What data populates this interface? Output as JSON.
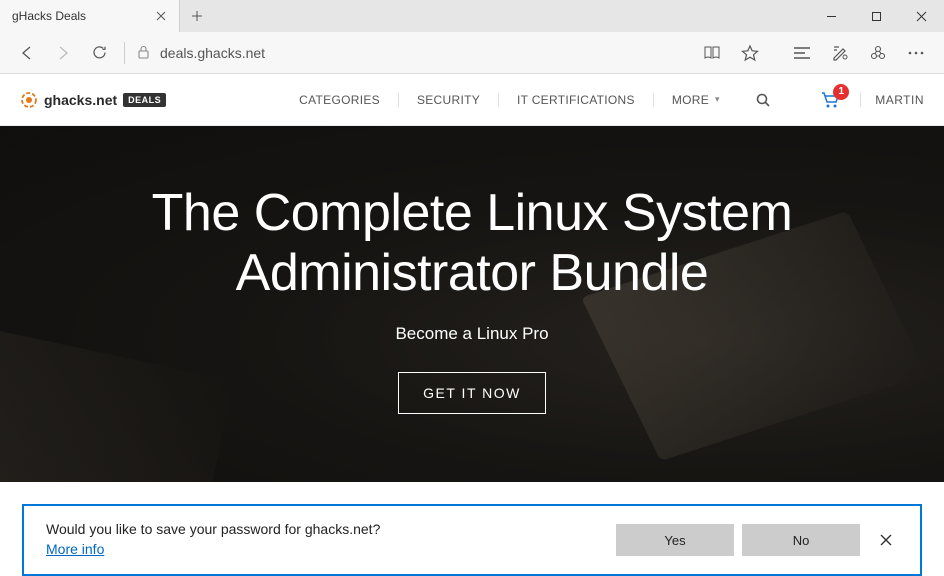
{
  "titlebar": {
    "tab_title": "gHacks Deals"
  },
  "addressbar": {
    "url": "deals.ghacks.net"
  },
  "site": {
    "logo_text": "ghacks.net",
    "logo_badge": "DEALS",
    "nav": {
      "categories": "CATEGORIES",
      "security": "SECURITY",
      "it_cert": "IT CERTIFICATIONS",
      "more": "MORE"
    },
    "cart_count": "1",
    "username": "MARTIN"
  },
  "hero": {
    "title_line1": "The Complete Linux System",
    "title_line2": "Administrator Bundle",
    "subtitle": "Become a Linux Pro",
    "cta": "GET IT NOW"
  },
  "prompt": {
    "message": "Would you like to save your password for ghacks.net?",
    "more_info": "More info",
    "yes": "Yes",
    "no": "No"
  }
}
